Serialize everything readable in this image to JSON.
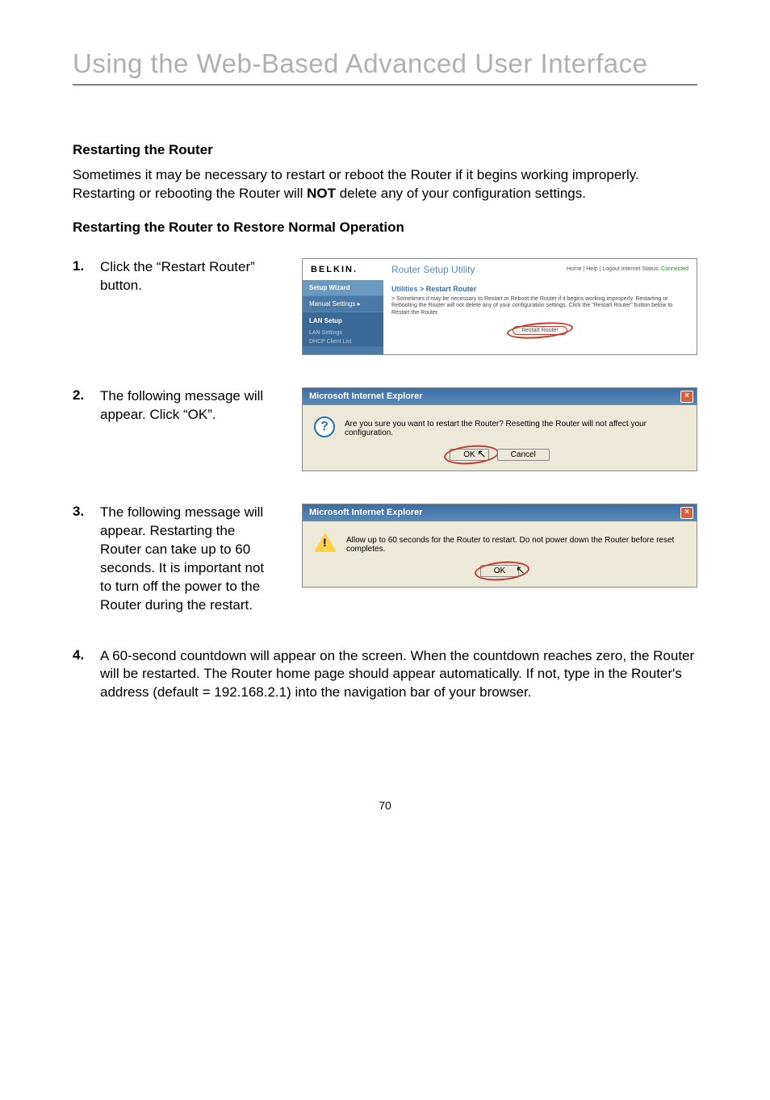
{
  "page_title": "Using the Web-Based Advanced User Interface",
  "section_heading": "Restarting the Router",
  "intro_p1": "Sometimes it may be necessary to restart or reboot the Router if it begins working improperly. Restarting or rebooting the Router will ",
  "intro_bold": "NOT",
  "intro_p2": " delete any of your configuration settings.",
  "subheading": "Restarting the Router to Restore Normal Operation",
  "steps": {
    "s1": {
      "num": "1.",
      "text": "Click the “Restart Router” button."
    },
    "s2": {
      "num": "2.",
      "text": "The following message will appear. Click “OK”."
    },
    "s3": {
      "num": "3.",
      "text": "The following message will appear. Restarting the Router can take up to 60 seconds. It is important not to turn off the power to the Router during the restart."
    },
    "s4": {
      "num": "4.",
      "text": "A 60-second countdown will appear on the screen. When the countdown reaches zero, the Router will be restarted. The Router home page should appear automatically. If not, type in the Router's address (default = 192.168.2.1) into the navigation bar of your browser."
    }
  },
  "router": {
    "logo": "BELKIN.",
    "utility_title": "Router Setup Utility",
    "top_links_prefix": "Home | Help | Logout   Internet Status: ",
    "connected": "Connected",
    "sidebar": {
      "setup": "Setup Wizard",
      "manual": "Manual Settings ▸",
      "lan": "LAN Setup",
      "lan_settings": "LAN Settings",
      "dhcp": "DHCP Client List"
    },
    "crumb_root": "Utilities > ",
    "crumb_leaf": "Restart Router",
    "desc": "> Sometimes it may be necessary to Restart or Reboot the Router if it begins working improperly. Restarting or Rebooting the Router will not delete any of your configuration settings. Click the \"Restart Router\" button below to Restart the Router.",
    "restart_btn": "Restart Router"
  },
  "dialog2": {
    "title": "Microsoft Internet Explorer",
    "msg": "Are you sure you want to restart the Router? Resetting the Router will not affect your configuration.",
    "ok": "OK",
    "cancel": "Cancel"
  },
  "dialog3": {
    "title": "Microsoft Internet Explorer",
    "msg": "Allow up to 60 seconds for the Router to restart. Do not power down the Router before reset completes.",
    "ok": "OK"
  },
  "page_number": "70"
}
